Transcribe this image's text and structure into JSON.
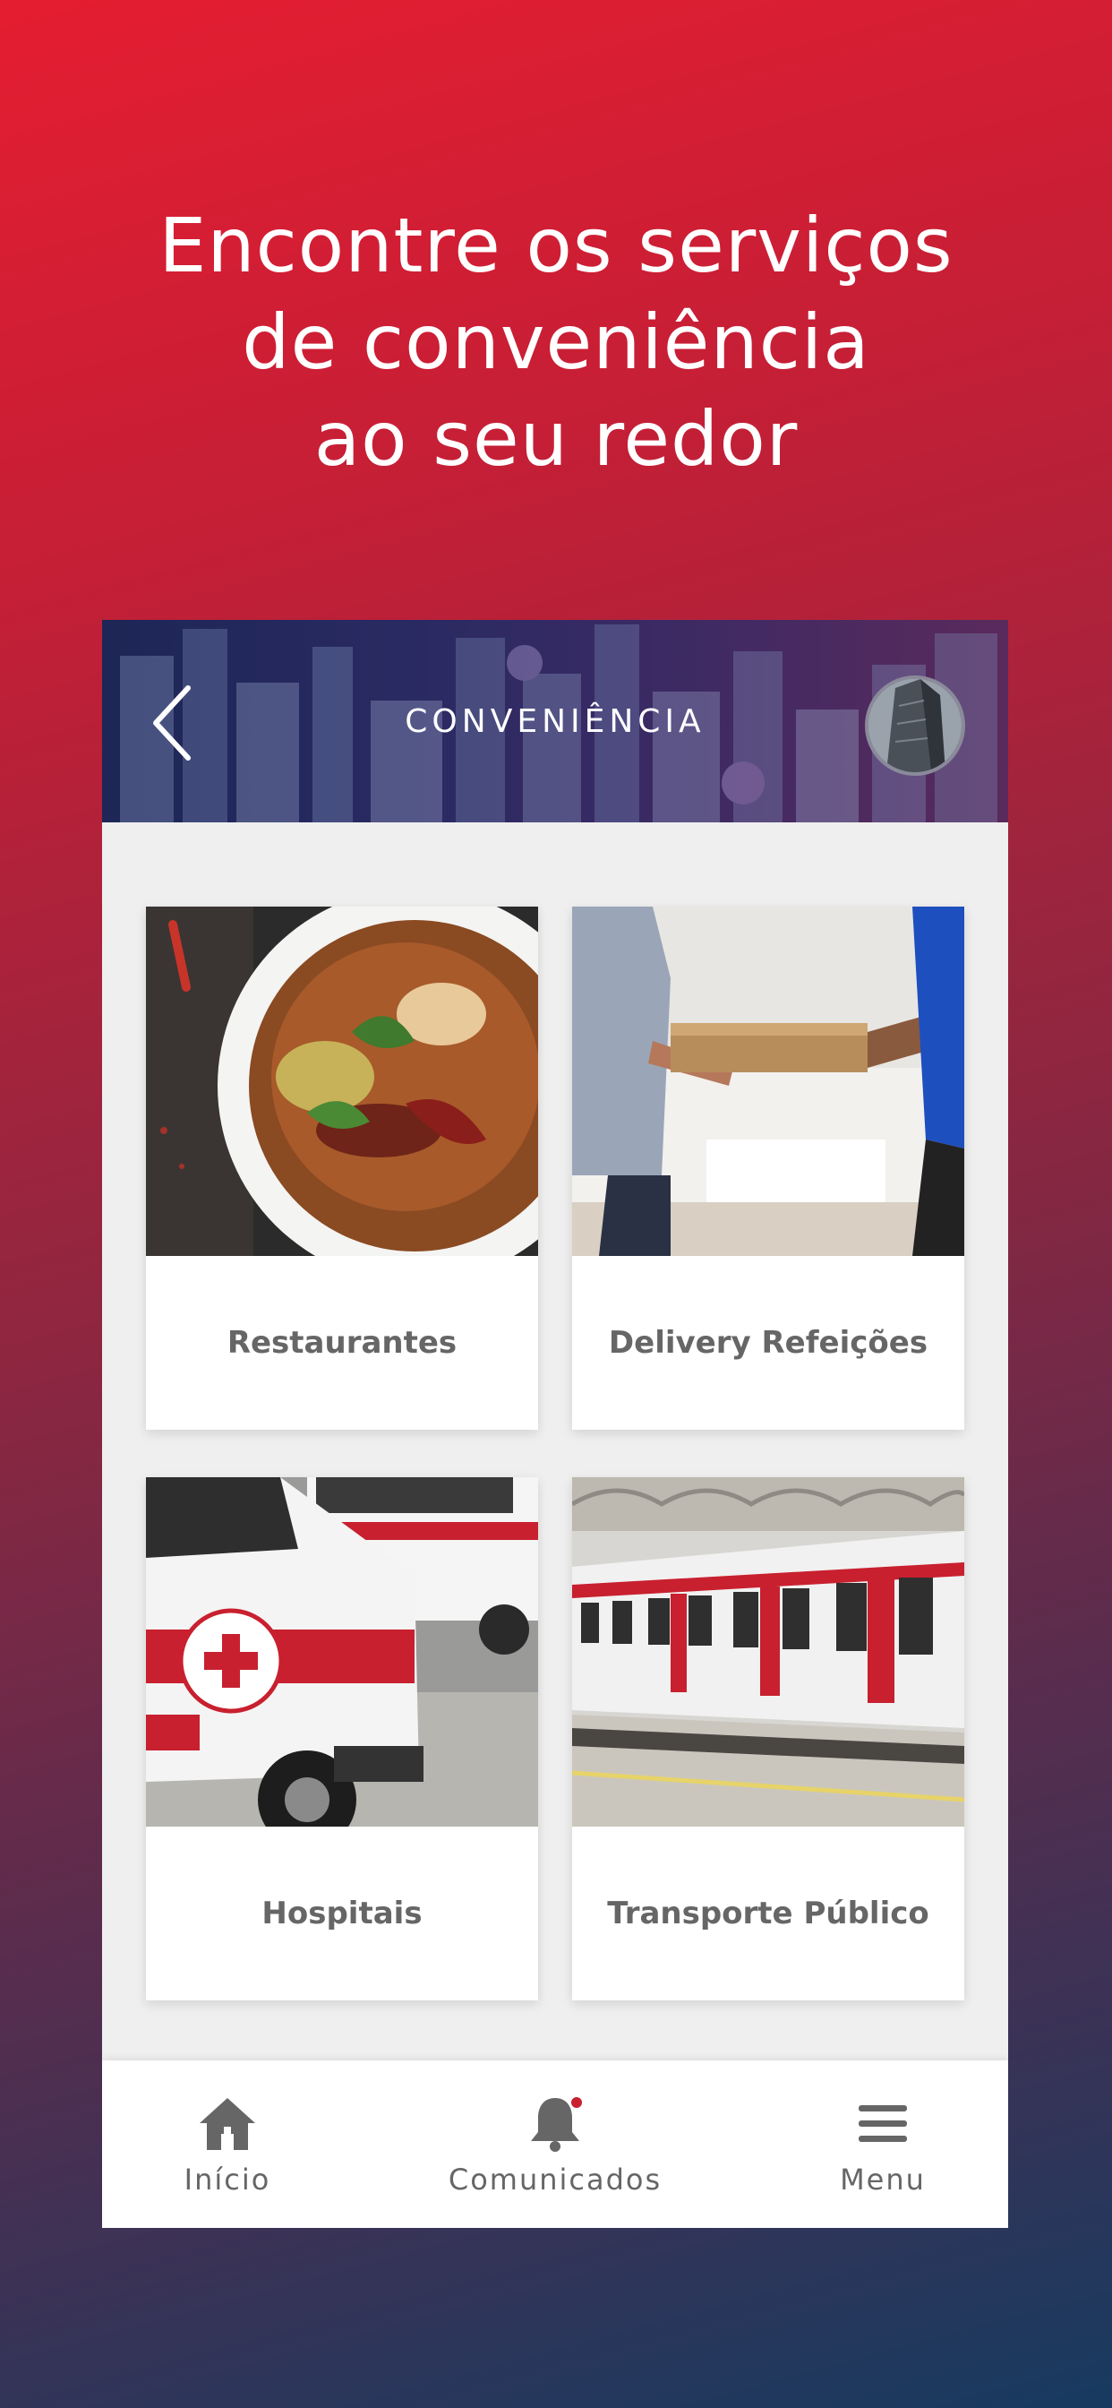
{
  "headline": {
    "line1": "Encontre os serviços",
    "line2": "de conveniência",
    "line3": "ao seu redor"
  },
  "header": {
    "title": "CONVENIÊNCIA",
    "back_icon": "chevron-left-icon",
    "avatar_icon": "avatar"
  },
  "categories": [
    {
      "label": "Restaurantes",
      "image": "food-bowl-photo"
    },
    {
      "label": "Delivery Refeições",
      "image": "pizza-delivery-photo"
    },
    {
      "label": "Hospitais",
      "image": "ambulance-photo"
    },
    {
      "label": "Transporte Público",
      "image": "subway-train-photo"
    }
  ],
  "tabbar": {
    "items": [
      {
        "label": "Início",
        "icon": "home-icon"
      },
      {
        "label": "Comunicados",
        "icon": "bell-icon",
        "has_notification": true
      },
      {
        "label": "Menu",
        "icon": "hamburger-menu-icon"
      }
    ]
  },
  "colors": {
    "gradient_top": "#e51d31",
    "gradient_bottom": "#173a60",
    "header_bg": "#2a2a62",
    "notification": "#c8202f",
    "label_gray": "#666666"
  }
}
